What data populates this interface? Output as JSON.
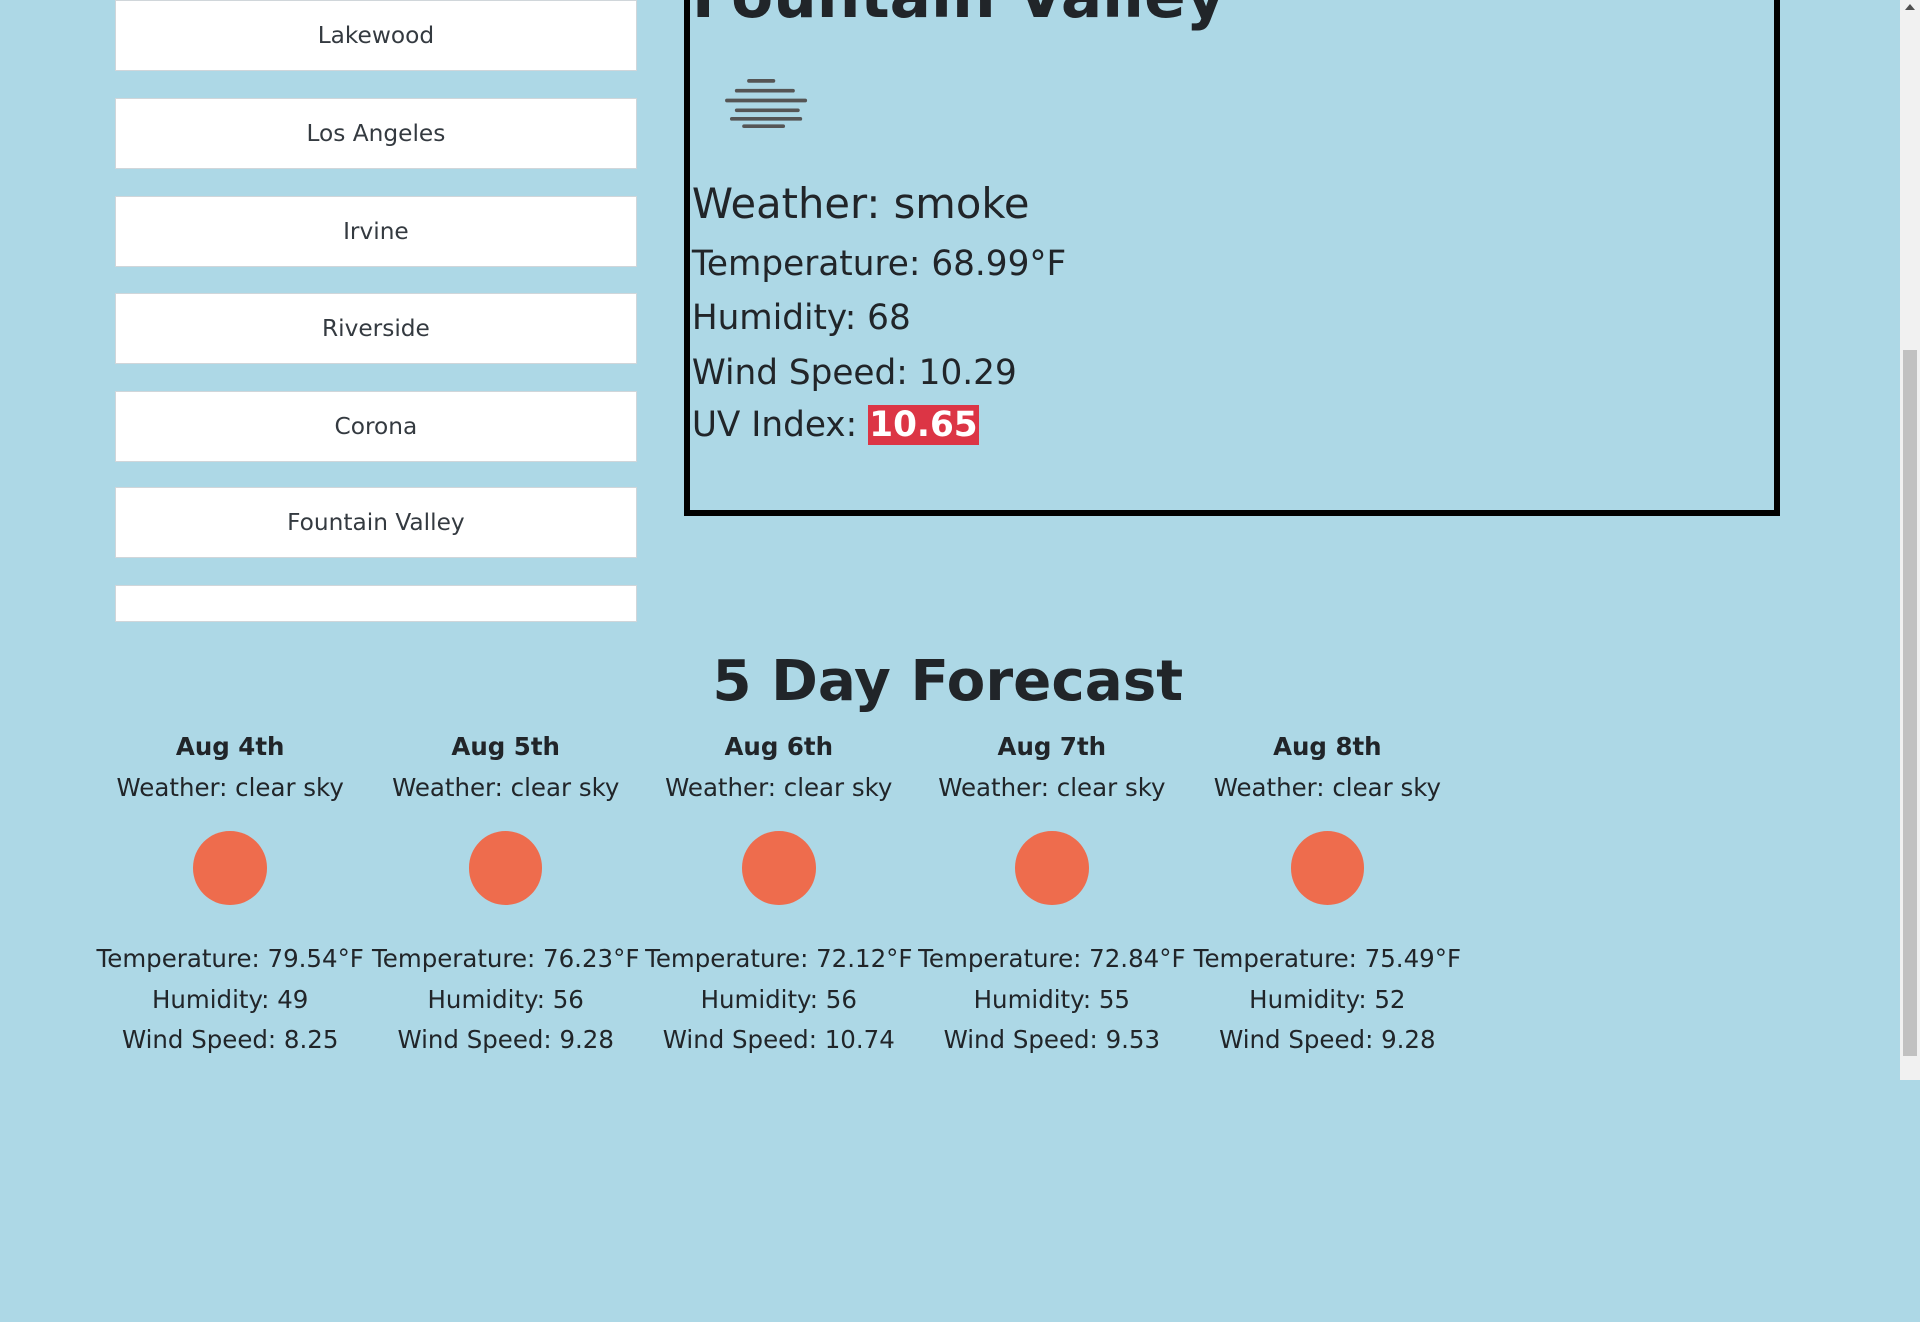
{
  "cities": [
    "Lakewood",
    "Los Angeles",
    "Irvine",
    "Riverside",
    "Corona",
    "Fountain Valley",
    ""
  ],
  "current": {
    "city": "Fountain Valley",
    "weather": "Weather: smoke",
    "temperature": "Temperature: 68.99°F",
    "humidity": "Humidity: 68",
    "wind": "Wind Speed: 10.29",
    "uv_label": "UV Index:",
    "uv_value": "10.65",
    "uv_color": "#dc3545",
    "icon": "smoke-icon"
  },
  "forecast_title": "5 Day Forecast",
  "forecast": [
    {
      "date": "Aug 4th",
      "weather": "Weather: clear sky",
      "temp": "Temperature: 79.54°F",
      "humidity": "Humidity: 49",
      "wind": "Wind Speed: 8.25",
      "icon": "sun-icon"
    },
    {
      "date": "Aug 5th",
      "weather": "Weather: clear sky",
      "temp": "Temperature: 76.23°F",
      "humidity": "Humidity: 56",
      "wind": "Wind Speed: 9.28",
      "icon": "sun-icon"
    },
    {
      "date": "Aug 6th",
      "weather": "Weather: clear sky",
      "temp": "Temperature: 72.12°F",
      "humidity": "Humidity: 56",
      "wind": "Wind Speed: 10.74",
      "icon": "sun-icon"
    },
    {
      "date": "Aug 7th",
      "weather": "Weather: clear sky",
      "temp": "Temperature: 72.84°F",
      "humidity": "Humidity: 55",
      "wind": "Wind Speed: 9.53",
      "icon": "sun-icon"
    },
    {
      "date": "Aug 8th",
      "weather": "Weather: clear sky",
      "temp": "Temperature: 75.49°F",
      "humidity": "Humidity: 52",
      "wind": "Wind Speed: 9.28",
      "icon": "sun-icon"
    }
  ],
  "colors": {
    "background": "#add8e6",
    "sun": "#ee6c4d",
    "uv_high": "#dc3545"
  }
}
